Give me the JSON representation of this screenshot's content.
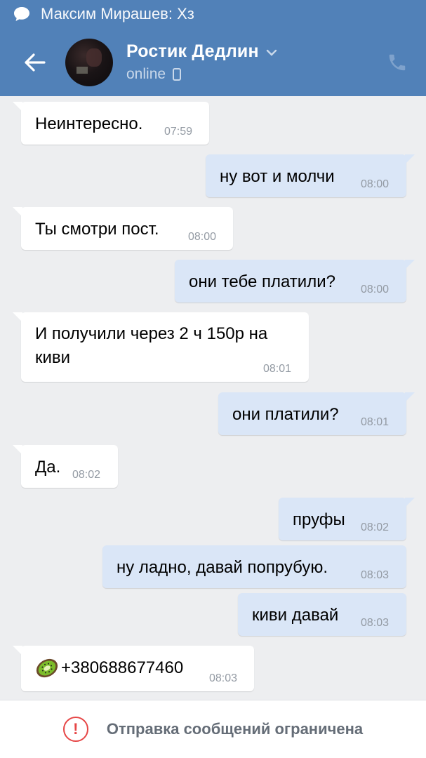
{
  "notification": {
    "text": "Максим Мирашев: Хз",
    "icon": "chat-bubble-icon"
  },
  "header": {
    "contact_name": "Ростик Дедлин",
    "status": "online",
    "back_icon": "arrow-left-icon",
    "call_icon": "phone-icon"
  },
  "messages": [
    {
      "direction": "in",
      "text": "Неинтересно.",
      "time": "07:59"
    },
    {
      "direction": "out",
      "text": "ну вот и молчи",
      "time": "08:00"
    },
    {
      "direction": "in",
      "text": "Ты смотри пост.",
      "time": "08:00"
    },
    {
      "direction": "out",
      "text": "они тебе платили?",
      "time": "08:00"
    },
    {
      "direction": "in",
      "text": "И получили через 2 ч 150р на киви",
      "time": "08:01"
    },
    {
      "direction": "out",
      "text": "они платили?",
      "time": "08:01"
    },
    {
      "direction": "in",
      "text": "Да.",
      "time": "08:02"
    },
    {
      "direction": "out",
      "text": "пруфы",
      "time": "08:02"
    },
    {
      "direction": "out",
      "text": "ну ладно, давай попрубую.",
      "time": "08:03"
    },
    {
      "direction": "out",
      "text": "киви давай",
      "time": "08:03"
    },
    {
      "direction": "in",
      "text": "+380688677460",
      "emoji": "kiwi-icon",
      "time": "08:03"
    }
  ],
  "footer": {
    "text": "Отправка сообщений ограничена",
    "icon": "warning-icon"
  },
  "colors": {
    "header": "#5181b8",
    "incoming": "#ffffff",
    "outgoing": "#dae6f7",
    "background": "#edeef0",
    "link": "#2a5885",
    "warning": "#e64646"
  }
}
